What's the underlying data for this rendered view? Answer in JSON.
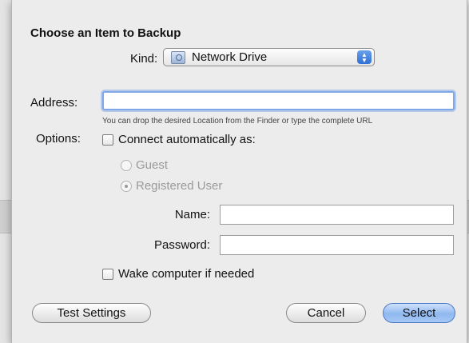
{
  "dialog": {
    "title": "Choose an Item to Backup",
    "kind_label": "Kind:",
    "kind_value": "Network Drive",
    "address_label": "Address:",
    "address_value": "",
    "address_hint": "You can drop the desired Location from the Finder or type the complete URL",
    "options_label": "Options:",
    "connect_label": "Connect automatically as:",
    "guest_label": "Guest",
    "registered_label": "Registered User",
    "name_label": "Name:",
    "password_label": "Password:",
    "wake_label": "Wake computer if needed",
    "test_button": "Test Settings",
    "cancel_button": "Cancel",
    "select_button": "Select"
  },
  "colors": {
    "accent": "#6aa0ea",
    "sheet_bg": "#ececec"
  }
}
